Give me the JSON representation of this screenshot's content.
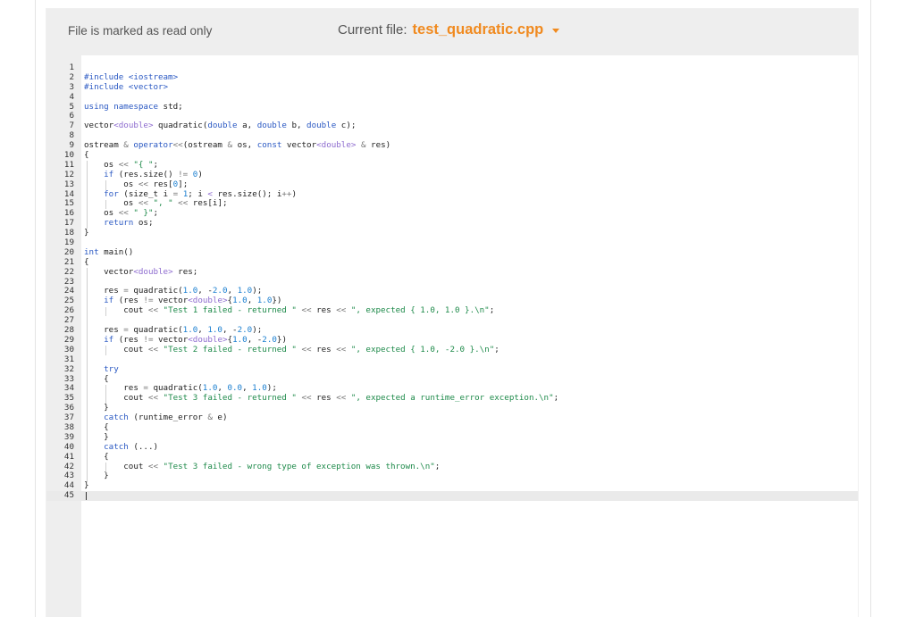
{
  "toolbar": {
    "readonly_text": "File is marked as read only",
    "current_file_label": "Current file:",
    "current_file_name": "test_quadratic.cpp"
  },
  "colors": {
    "file_name": "#f08a1f",
    "keyword": "#2b59c3",
    "type": "#8e6ccf",
    "string": "#1e8a4a",
    "number": "#1b7fd0"
  },
  "editor": {
    "cursor_line": 45,
    "lines": [
      "",
      "#include <iostream>",
      "#include <vector>",
      "",
      "using namespace std;",
      "",
      "vector<double> quadratic(double a, double b, double c);",
      "",
      "ostream & operator<<(ostream & os, const vector<double> & res)",
      "{",
      "    os << \"{ \";",
      "    if (res.size() != 0)",
      "        os << res[0];",
      "    for (size_t i = 1; i < res.size(); i++)",
      "        os << \", \" << res[i];",
      "    os << \" }\";",
      "    return os;",
      "}",
      "",
      "int main()",
      "{",
      "    vector<double> res;",
      "",
      "    res = quadratic(1.0, -2.0, 1.0);",
      "    if (res != vector<double>{1.0, 1.0})",
      "        cout << \"Test 1 failed - returned \" << res << \", expected { 1.0, 1.0 }.\\n\";",
      "",
      "    res = quadratic(1.0, 1.0, -2.0);",
      "    if (res != vector<double>{1.0, -2.0})",
      "        cout << \"Test 2 failed - returned \" << res << \", expected { 1.0, -2.0 }.\\n\";",
      "",
      "    try",
      "    {",
      "        res = quadratic(1.0, 0.0, 1.0);",
      "        cout << \"Test 3 failed - returned \" << res << \", expected a runtime_error exception.\\n\";",
      "    }",
      "    catch (runtime_error & e)",
      "    {",
      "    }",
      "    catch (...)",
      "    {",
      "        cout << \"Test 3 failed - wrong type of exception was thrown.\\n\";",
      "    }",
      "}",
      ""
    ]
  }
}
